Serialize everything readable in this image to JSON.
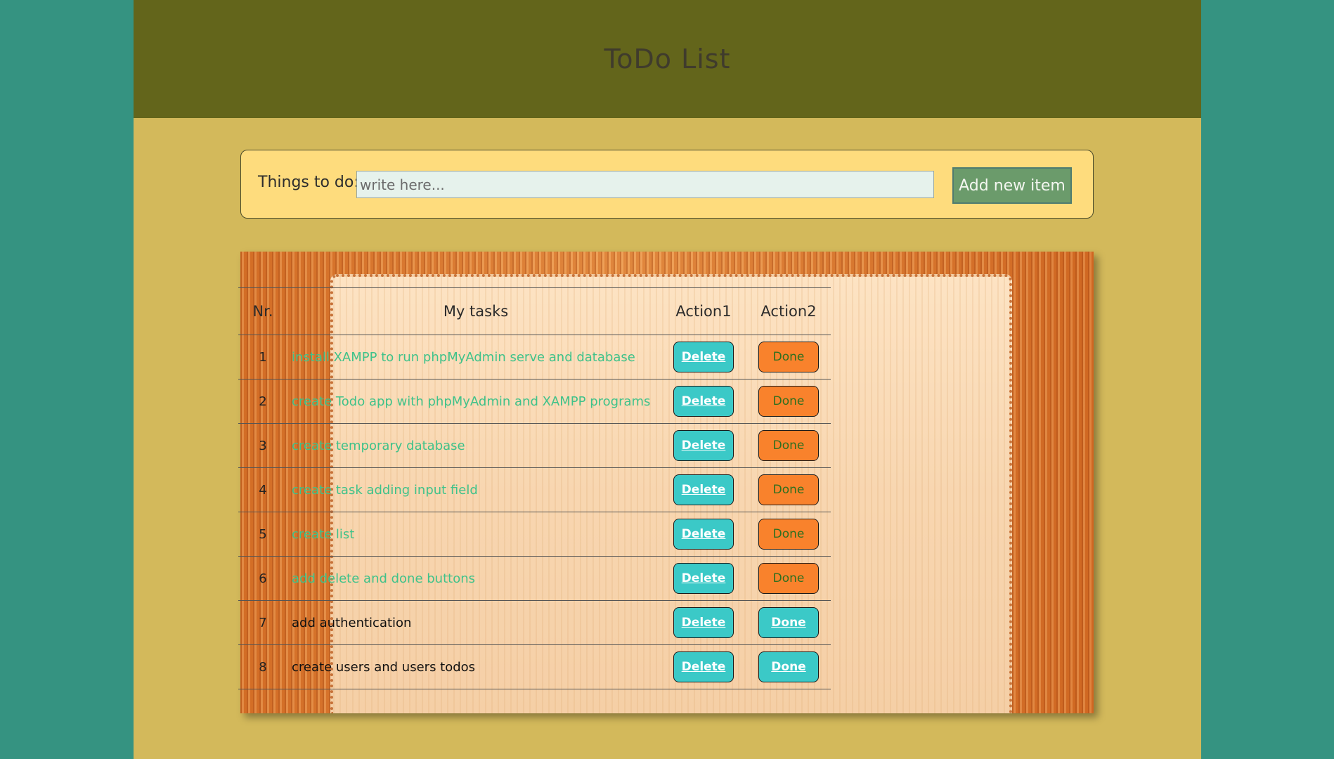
{
  "header": {
    "title": "ToDo List"
  },
  "form": {
    "label": "Things to do:",
    "input_value": "",
    "input_placeholder": "write here...",
    "add_button_label": "Add new item"
  },
  "table": {
    "headers": [
      "Nr.",
      "My tasks",
      "Action1",
      "Action2"
    ],
    "rows": [
      {
        "nr": "1",
        "task": "install XAMPP to run phpMyAdmin serve and database",
        "delete_label": "Delete",
        "done_label": "Done",
        "status": "active"
      },
      {
        "nr": "2",
        "task": "create Todo app with phpMyAdmin and XAMPP programs",
        "delete_label": "Delete",
        "done_label": "Done",
        "status": "active"
      },
      {
        "nr": "3",
        "task": "create temporary database",
        "delete_label": "Delete",
        "done_label": "Done",
        "status": "active"
      },
      {
        "nr": "4",
        "task": "create task adding input field",
        "delete_label": "Delete",
        "done_label": "Done",
        "status": "active"
      },
      {
        "nr": "5",
        "task": "create list",
        "delete_label": "Delete",
        "done_label": "Done",
        "status": "active"
      },
      {
        "nr": "6",
        "task": "add delete and done buttons",
        "delete_label": "Delete",
        "done_label": "Done",
        "status": "active"
      },
      {
        "nr": "7",
        "task": "add authentication",
        "delete_label": "Delete",
        "done_label": "Done",
        "status": "done"
      },
      {
        "nr": "8",
        "task": "create users and users todos",
        "delete_label": "Delete",
        "done_label": "Done",
        "status": "done"
      }
    ]
  },
  "colors": {
    "background": "#359381",
    "page": "#d3b95b",
    "header": "#63651b",
    "form_panel": "#fedc7d",
    "add_button": "#6b9b6b",
    "delete_button": "#3bc9c7",
    "done_button_pending": "#f9822c",
    "done_button_completed": "#3bc9c7",
    "active_task_text": "#3fc28a"
  }
}
